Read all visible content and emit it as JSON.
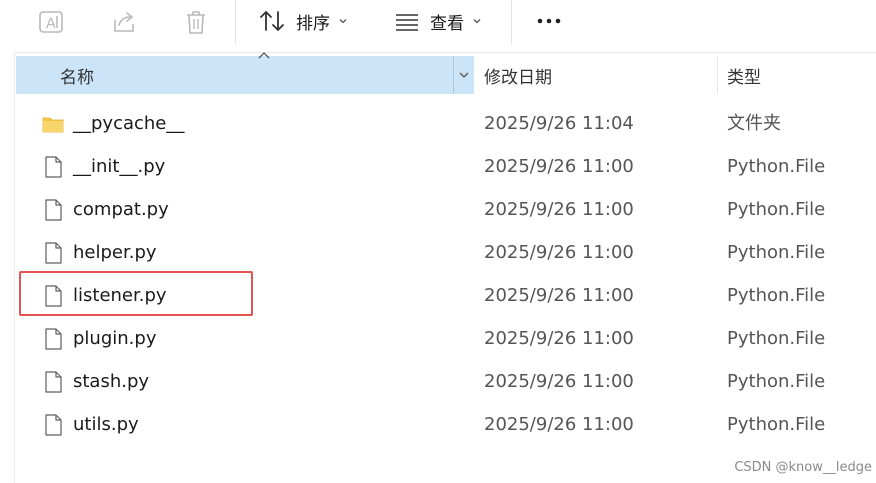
{
  "toolbar": {
    "sort_label": "排序",
    "view_label": "查看",
    "icons": [
      "rename-icon",
      "share-icon",
      "delete-icon",
      "sort-icon",
      "view-icon",
      "more-icon"
    ]
  },
  "columns": {
    "name": "名称",
    "date": "修改日期",
    "type": "类型"
  },
  "files": [
    {
      "name": "__pycache__",
      "date": "2025/9/26 11:04",
      "type": "文件夹",
      "kind": "folder"
    },
    {
      "name": "__init__.py",
      "date": "2025/9/26 11:00",
      "type": "Python.File",
      "kind": "file"
    },
    {
      "name": "compat.py",
      "date": "2025/9/26 11:00",
      "type": "Python.File",
      "kind": "file"
    },
    {
      "name": "helper.py",
      "date": "2025/9/26 11:00",
      "type": "Python.File",
      "kind": "file"
    },
    {
      "name": "listener.py",
      "date": "2025/9/26 11:00",
      "type": "Python.File",
      "kind": "file"
    },
    {
      "name": "plugin.py",
      "date": "2025/9/26 11:00",
      "type": "Python.File",
      "kind": "file"
    },
    {
      "name": "stash.py",
      "date": "2025/9/26 11:00",
      "type": "Python.File",
      "kind": "file"
    },
    {
      "name": "utils.py",
      "date": "2025/9/26 11:00",
      "type": "Python.File",
      "kind": "file"
    }
  ],
  "watermark": "CSDN @know__ledge",
  "colors": {
    "header_selected": "#cce4f7",
    "highlight_box": "#e55353",
    "folder": "#f3c74a"
  }
}
